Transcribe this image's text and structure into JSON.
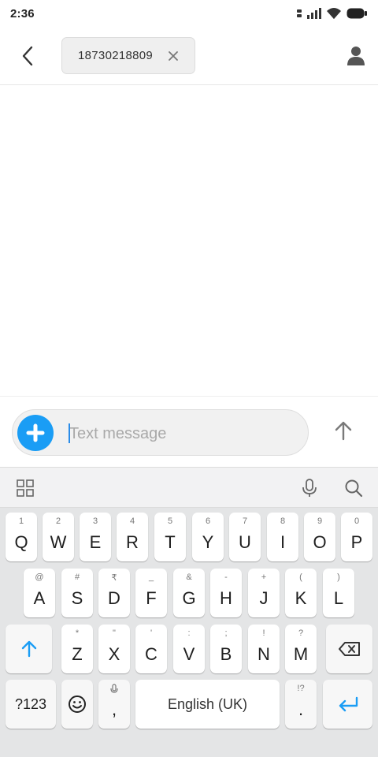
{
  "status_bar": {
    "time": "2:36"
  },
  "header": {
    "recipient": "18730218809"
  },
  "compose": {
    "placeholder": "Text message"
  },
  "keyboard": {
    "row1": [
      {
        "main": "Q",
        "sub": "1"
      },
      {
        "main": "W",
        "sub": "2"
      },
      {
        "main": "E",
        "sub": "3"
      },
      {
        "main": "R",
        "sub": "4"
      },
      {
        "main": "T",
        "sub": "5"
      },
      {
        "main": "Y",
        "sub": "6"
      },
      {
        "main": "U",
        "sub": "7"
      },
      {
        "main": "I",
        "sub": "8"
      },
      {
        "main": "O",
        "sub": "9"
      },
      {
        "main": "P",
        "sub": "0"
      }
    ],
    "row2": [
      {
        "main": "A",
        "sub": "@"
      },
      {
        "main": "S",
        "sub": "#"
      },
      {
        "main": "D",
        "sub": "₹"
      },
      {
        "main": "F",
        "sub": "_"
      },
      {
        "main": "G",
        "sub": "&"
      },
      {
        "main": "H",
        "sub": "-"
      },
      {
        "main": "J",
        "sub": "+"
      },
      {
        "main": "K",
        "sub": "("
      },
      {
        "main": "L",
        "sub": ")"
      }
    ],
    "row3": [
      {
        "main": "Z",
        "sub": "*"
      },
      {
        "main": "X",
        "sub": "\""
      },
      {
        "main": "C",
        "sub": "'"
      },
      {
        "main": "V",
        "sub": ":"
      },
      {
        "main": "B",
        "sub": ";"
      },
      {
        "main": "N",
        "sub": "!"
      },
      {
        "main": "M",
        "sub": "?"
      }
    ],
    "symbols_label": "?123",
    "comma": ",",
    "space_label": "English (UK)",
    "period": ".",
    "period_sub": "!?"
  },
  "colors": {
    "accent": "#1a9df5",
    "keyboard_bg": "#e4e5e6"
  }
}
